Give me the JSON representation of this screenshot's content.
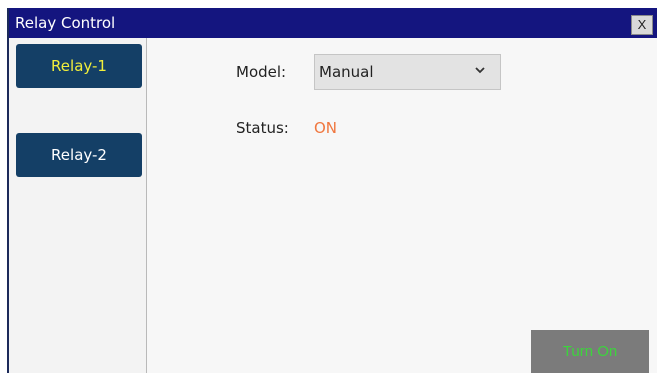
{
  "window": {
    "title": "Relay Control",
    "close_label": "X"
  },
  "sidebar": {
    "items": [
      {
        "label": "Relay-1",
        "active": true
      },
      {
        "label": "Relay-2",
        "active": false
      }
    ]
  },
  "main": {
    "model_label": "Model:",
    "model_value": "Manual",
    "status_label": "Status:",
    "status_value": "ON",
    "action_label": "Turn On"
  },
  "colors": {
    "titlebar": "#14157f",
    "relay_button": "#143f66",
    "active_text": "#f2ef3b",
    "status_on": "#f0773f",
    "action_text": "#3cd43c"
  },
  "icons": {
    "select_arrow": "chevron-down-icon"
  }
}
